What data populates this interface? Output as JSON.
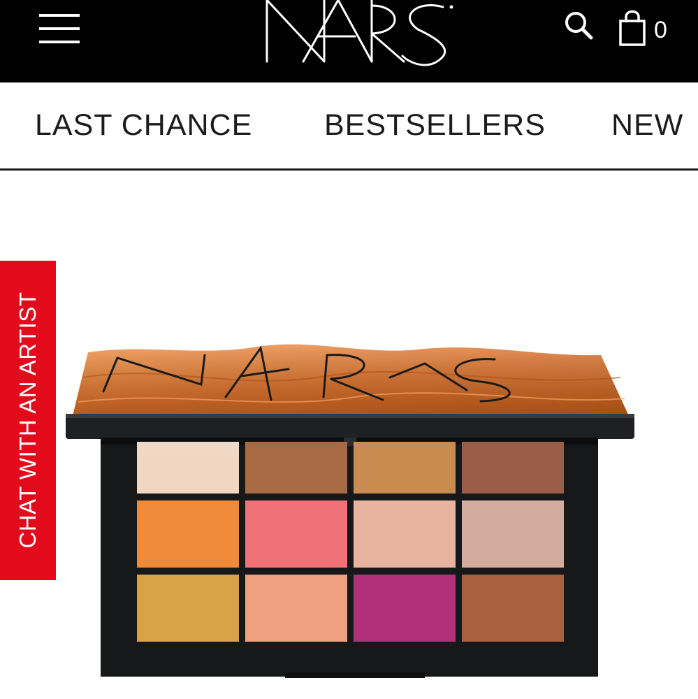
{
  "header": {
    "logo_text": "NARS",
    "menu_icon": "hamburger-menu-icon",
    "search_icon": "search-icon",
    "cart_icon": "shopping-bag-icon",
    "cart_count": "0"
  },
  "nav": {
    "items": [
      {
        "label": "LAST CHANCE"
      },
      {
        "label": "BESTSELLERS"
      },
      {
        "label": "NEW"
      }
    ]
  },
  "chat_tab": {
    "label": "CHAT WITH AN ARTIST"
  },
  "product": {
    "image_alt": "eyeshadow-palette",
    "colors": {
      "lid": "#e07a2b",
      "case": "#17181a",
      "accent_red": "#e30a1b"
    },
    "swatches": [
      [
        "#f1d6c2",
        "#a86a42",
        "#c8874a",
        "#9a5d48"
      ],
      [
        "#ef8a3a",
        "#f07177",
        "#e9b49f",
        "#d2a79a"
      ],
      [
        "#d6a040",
        "#f1a07f",
        "#b0307a",
        "#a8603f"
      ]
    ]
  }
}
